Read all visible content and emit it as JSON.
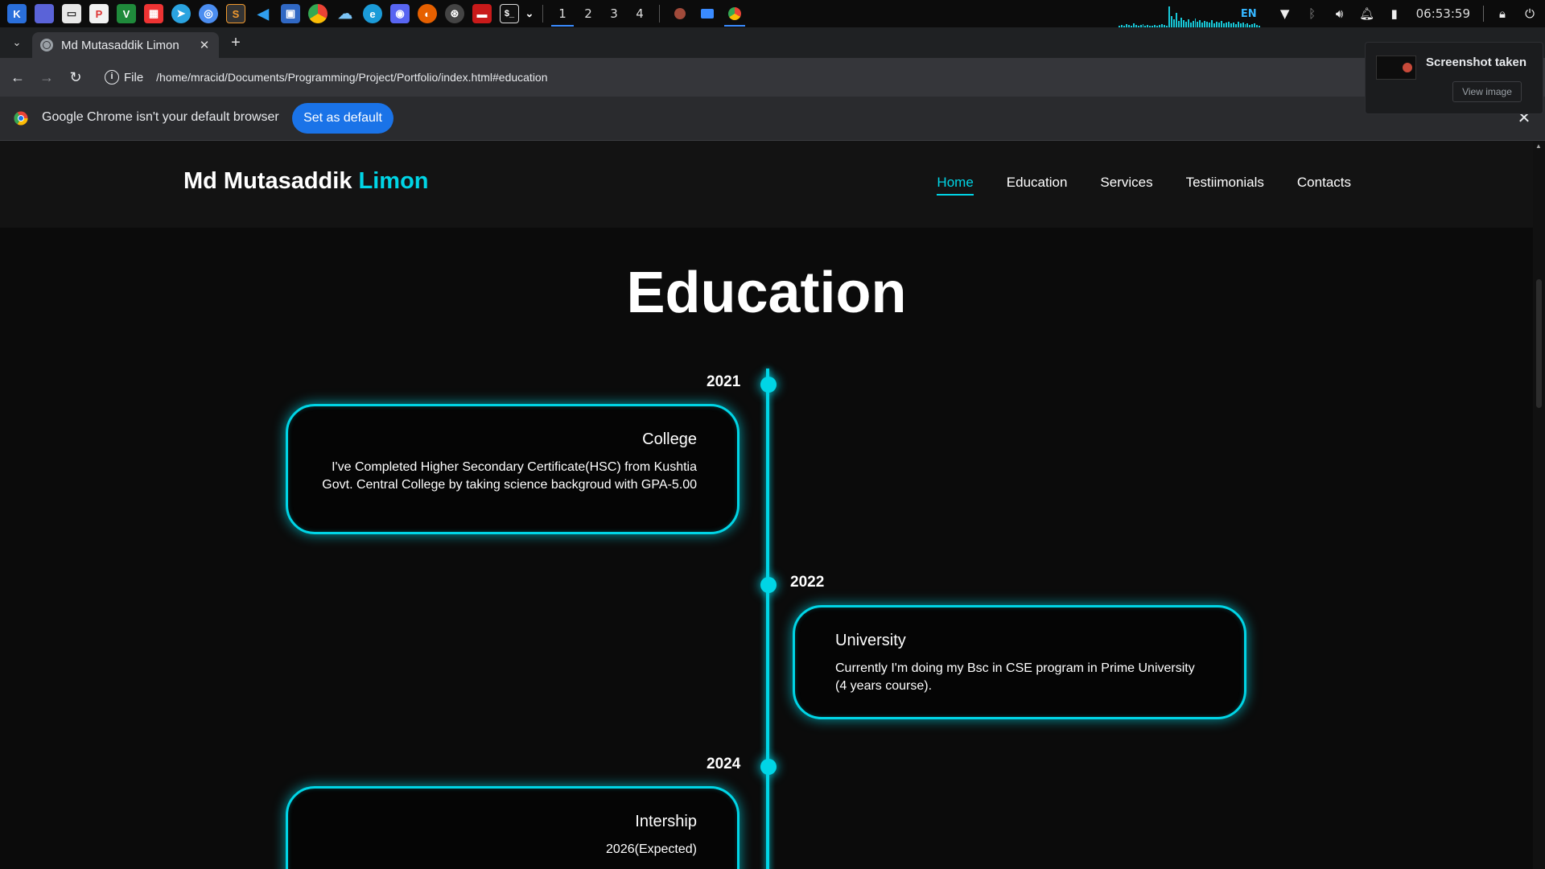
{
  "taskbar": {
    "workspaces": [
      "1",
      "2",
      "3",
      "4"
    ],
    "language": "EN",
    "clock": "06:53:59"
  },
  "browser": {
    "tab_title": "Md Mutasaddik Limon",
    "omnibox_scheme": "File",
    "url": "/home/mracid/Documents/Programming/Project/Portfolio/index.html#education",
    "infobar_text": "Google Chrome isn't your default browser",
    "infobar_button": "Set as default"
  },
  "toast": {
    "title": "Screenshot taken",
    "button": "View image"
  },
  "site": {
    "logo_first": "Md Mutasaddik ",
    "logo_accent": "Limon",
    "nav": [
      "Home",
      "Education",
      "Services",
      "Testiimonials",
      "Contacts"
    ],
    "active_nav": "Home",
    "accent_color": "#00d5e6"
  },
  "education": {
    "title": "Education",
    "items": [
      {
        "year": "2021",
        "heading": "College",
        "text": "I've Completed Higher Secondary Certificate(HSC) from Kushtia Govt. Central College by taking science backgroud with GPA-5.00"
      },
      {
        "year": "2022",
        "heading": "University",
        "text": "Currently I'm doing my Bsc in CSE program in Prime University (4 years course)."
      },
      {
        "year": "2024",
        "heading": "Intership",
        "text": "2026(Expected)"
      }
    ]
  }
}
